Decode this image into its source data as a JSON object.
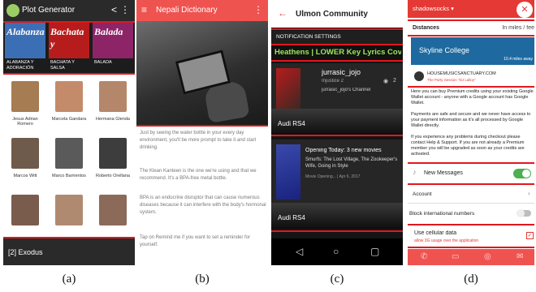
{
  "captions": [
    "(a)",
    "(b)",
    "(c)",
    "(d)"
  ],
  "colors": {
    "highlight": "#e0181e",
    "green": "#4caf50",
    "accent_red": "#ef5350"
  },
  "panel_a": {
    "title": "Plot Generator",
    "albums": [
      {
        "art_title": "Alabanza",
        "label": "ALABANZA Y ADORACIÓN",
        "color": "#3b6fb5"
      },
      {
        "art_title": "Bachata y",
        "label": "BACHATA Y SALSA",
        "color": "#b71c1c"
      },
      {
        "art_title": "Balada",
        "label": "BALADA",
        "color": "#8e2468"
      }
    ],
    "artists": [
      {
        "name": "Jesus Adrian Romero",
        "color": "#a67c52"
      },
      {
        "name": "Marcela Gandara",
        "color": "#c48b6a"
      },
      {
        "name": "Hermana Glenda",
        "color": "#b5876a"
      },
      {
        "name": "Marcos Witt",
        "color": "#6f5b4b"
      },
      {
        "name": "Marco Barrientos",
        "color": "#5a5a5a"
      },
      {
        "name": "Roberto Orellana",
        "color": "#3d3d3d"
      },
      {
        "name": "",
        "color": "#7a5c4c"
      },
      {
        "name": "",
        "color": "#b08a70"
      },
      {
        "name": "",
        "color": "#8b6a5a"
      }
    ],
    "footer": "[2] Exodus"
  },
  "panel_b": {
    "title": "Nepali Dictionary",
    "paragraphs": [
      "Just by seeing the water bottle in your every day environment, you'll be more prompt to take it and start drinking.",
      "The Klean Kanteen is the one we're using and that we recommend. It's a BPA-free metal bottle.",
      "BPA is an endocrine disruptor that can cause numerous diseases because it can interfere with the body's hormonal system.",
      "Tap on Remind me if you want to set a reminder for yourself."
    ]
  },
  "panel_c": {
    "title": "Ulmon Community",
    "section": "NOTIFICATION SETTINGS",
    "song": "Heathens | LOWER Key  Lyrics Cover...",
    "cards": [
      {
        "heading": "jurrasic_jojo",
        "sub": "Injustice 2",
        "channel": "jurrasic_jojo's Channel",
        "views": "2",
        "car": "Audi RS4"
      },
      {
        "heading": "Opening Today: 3 new movies",
        "sub": "Smurfs: The Lost Village, The Zookeeper's Wife, Going in Style",
        "channel": "Movie Opening... | Apr 6, 2017",
        "views": "",
        "car": "Audi RS4"
      }
    ]
  },
  "panel_d": {
    "title": "shadowsocks ▾",
    "distances_label": "Distances",
    "distances_value": "In miles / fee",
    "banner_title": "Skyline College",
    "banner_sub": "10.4 miles away",
    "site_name": "HOUSEMUSICSANCTUARY.COM",
    "site_sub": "The Party Session \"DJ Lalloy\"",
    "para1": "Here you can buy Premium credits using your existing Google Wallet account - anyone with a Google account has Google Wallet.",
    "para2": "Payments are safe and secure and we never have access to your payment information as it's all processed by Google Wallet directly.",
    "para3": "If you experience any problems during checkout please contact Help & Support. If you are not already a Premium member you will be upgraded as soon as your credits are activated.",
    "new_messages": "New Messages",
    "account": "Account",
    "block_intl": "Block international numbers",
    "cellular": "Use cellular data",
    "cellular_sub": "allow 3G usage over the application"
  }
}
